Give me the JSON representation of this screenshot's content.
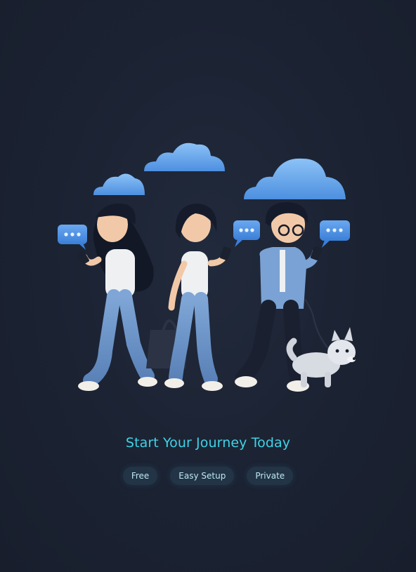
{
  "hero": {
    "headline": "Start Your Journey Today",
    "headline_color": "#3fd3e6"
  },
  "chips": [
    {
      "label": "Free"
    },
    {
      "label": "Easy Setup"
    },
    {
      "label": "Private"
    }
  ],
  "colors": {
    "background": "#1b2232",
    "chip_background": "#223446",
    "chip_text": "#bfe8f2",
    "cloud": "#6fb0f0",
    "bubble": "#4a8fe0"
  }
}
